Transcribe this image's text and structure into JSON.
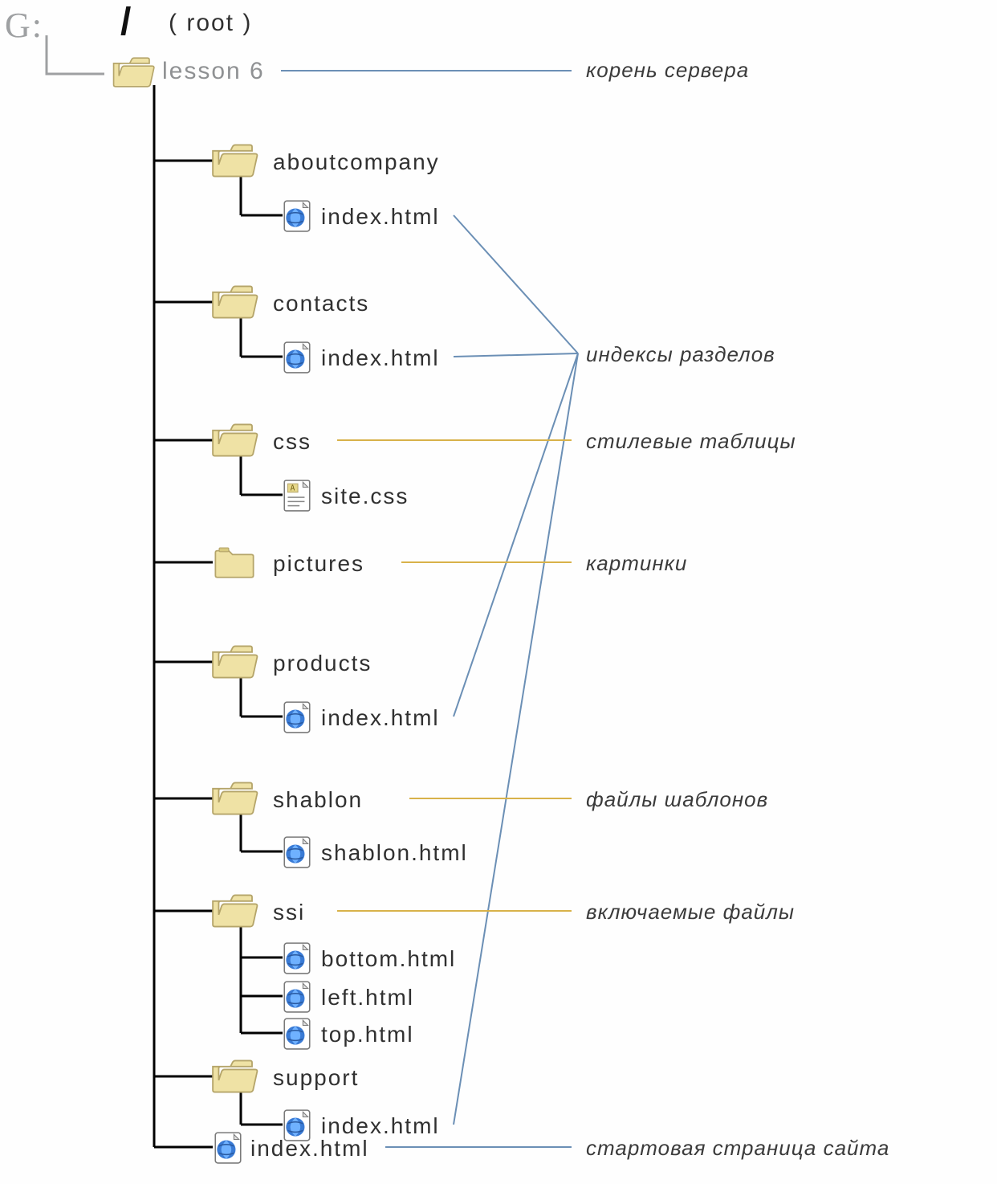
{
  "drive_label": "G:",
  "root_path_label": "( root )",
  "tree": {
    "root_folder": "lesson 6",
    "children": [
      {
        "name": "aboutcompany",
        "type": "folder",
        "children": [
          {
            "name": "index.html",
            "type": "html"
          }
        ]
      },
      {
        "name": "contacts",
        "type": "folder",
        "children": [
          {
            "name": "index.html",
            "type": "html"
          }
        ]
      },
      {
        "name": "css",
        "type": "folder",
        "children": [
          {
            "name": "site.css",
            "type": "css"
          }
        ]
      },
      {
        "name": "pictures",
        "type": "folder",
        "children": []
      },
      {
        "name": "products",
        "type": "folder",
        "children": [
          {
            "name": "index.html",
            "type": "html"
          }
        ]
      },
      {
        "name": "shablon",
        "type": "folder",
        "children": [
          {
            "name": "shablon.html",
            "type": "html"
          }
        ]
      },
      {
        "name": "ssi",
        "type": "folder",
        "children": [
          {
            "name": "bottom.html",
            "type": "html"
          },
          {
            "name": "left.html",
            "type": "html"
          },
          {
            "name": "top.html",
            "type": "html"
          }
        ]
      },
      {
        "name": "support",
        "type": "folder",
        "children": [
          {
            "name": "index.html",
            "type": "html"
          }
        ]
      },
      {
        "name": "index.html",
        "type": "html"
      }
    ]
  },
  "annotations": {
    "server_root": "корень сервера",
    "section_index": "индексы разделов",
    "stylesheets": "стилевые таблицы",
    "pictures": "картинки",
    "templates": "файлы шаблонов",
    "includes": "включаемые файлы",
    "start_page": "стартовая страница сайта"
  }
}
